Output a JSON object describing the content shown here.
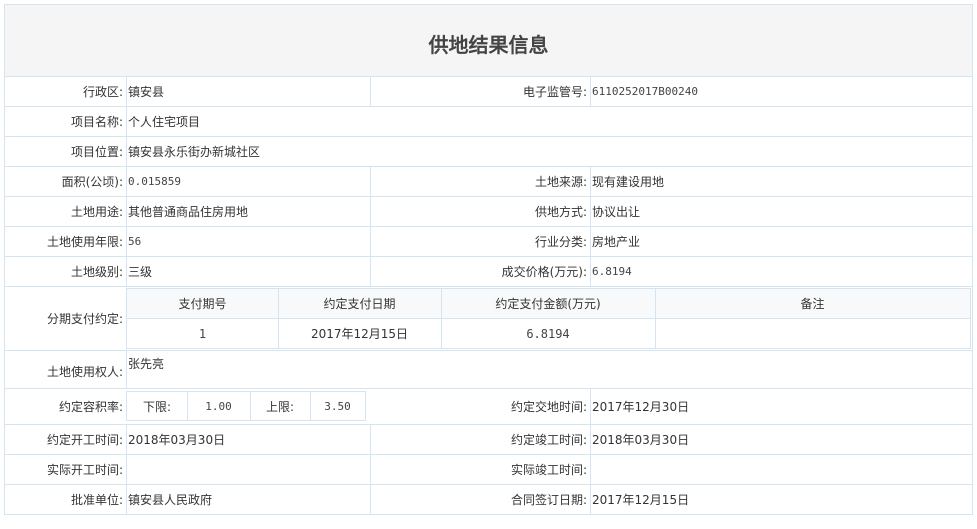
{
  "title": "供地结果信息",
  "region": {
    "label": "行政区:",
    "value": "镇安县"
  },
  "supervision_no": {
    "label": "电子监管号:",
    "value": "6110252017B00240"
  },
  "project_name": {
    "label": "项目名称:",
    "value": "个人住宅项目"
  },
  "project_location": {
    "label": "项目位置:",
    "value": "镇安县永乐街办新城社区"
  },
  "area": {
    "label": "面积(公顷):",
    "value": "0.015859"
  },
  "land_source": {
    "label": "土地来源:",
    "value": "现有建设用地"
  },
  "land_use": {
    "label": "土地用途:",
    "value": "其他普通商品住房用地"
  },
  "supply_method": {
    "label": "供地方式:",
    "value": "协议出让"
  },
  "use_years": {
    "label": "土地使用年限:",
    "value": "56"
  },
  "industry": {
    "label": "行业分类:",
    "value": "房地产业"
  },
  "land_grade": {
    "label": "土地级别:",
    "value": "三级"
  },
  "deal_price": {
    "label": "成交价格(万元):",
    "value": "6.8194"
  },
  "installments": {
    "label": "分期支付约定:",
    "headers": [
      "支付期号",
      "约定支付日期",
      "约定支付金额(万元)",
      "备注"
    ],
    "rows": [
      {
        "period": "1",
        "date": "2017年12月15日",
        "amount": "6.8194",
        "note": ""
      }
    ]
  },
  "land_user": {
    "label": "土地使用权人:",
    "value": "张先亮"
  },
  "far": {
    "label": "约定容积率:",
    "lower_label": "下限:",
    "lower": "1.00",
    "upper_label": "上限:",
    "upper": "3.50"
  },
  "handover_date": {
    "label": "约定交地时间:",
    "value": "2017年12月30日"
  },
  "start_date": {
    "label": "约定开工时间:",
    "value": "2018年03月30日"
  },
  "completion_date": {
    "label": "约定竣工时间:",
    "value": "2018年03月30日"
  },
  "actual_start": {
    "label": "实际开工时间:",
    "value": ""
  },
  "actual_completion": {
    "label": "实际竣工时间:",
    "value": ""
  },
  "approval_unit": {
    "label": "批准单位:",
    "value": "镇安县人民政府"
  },
  "contract_date": {
    "label": "合同签订日期:",
    "value": "2017年12月15日"
  }
}
